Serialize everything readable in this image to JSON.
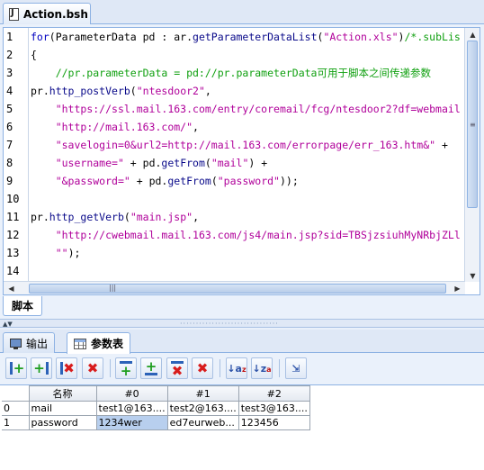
{
  "editor": {
    "file_tab": "Action.bsh",
    "bottom_tab": "脚本",
    "line_numbers": [
      "1",
      "2",
      "3",
      "4",
      "5",
      "6",
      "7",
      "8",
      "9",
      "10",
      "11",
      "12",
      "13",
      "14"
    ],
    "lines": [
      [
        {
          "t": "for",
          "c": "kw"
        },
        {
          "t": "(ParameterData pd : ar."
        },
        {
          "t": "getParameterDataList",
          "c": "fn"
        },
        {
          "t": "("
        },
        {
          "t": "\"Action.xls\"",
          "c": "str"
        },
        {
          "t": ")"
        },
        {
          "t": "/*.subLis",
          "c": "cmt"
        }
      ],
      [
        {
          "t": "{"
        }
      ],
      [
        {
          "t": "    //pr.parameterData = pd://pr.parameterData可用于脚本之间传递参数",
          "c": "cmt"
        }
      ],
      [
        {
          "t": "pr."
        },
        {
          "t": "http_postVerb",
          "c": "fn"
        },
        {
          "t": "("
        },
        {
          "t": "\"ntesdoor2\"",
          "c": "str"
        },
        {
          "t": ","
        }
      ],
      [
        {
          "t": "    "
        },
        {
          "t": "\"https://ssl.mail.163.com/entry/coremail/fcg/ntesdoor2?df=webmail",
          "c": "str"
        }
      ],
      [
        {
          "t": "    "
        },
        {
          "t": "\"http://mail.163.com/\"",
          "c": "str"
        },
        {
          "t": ","
        }
      ],
      [
        {
          "t": "    "
        },
        {
          "t": "\"savelogin=0&url2=http://mail.163.com/errorpage/err_163.htm&\"",
          "c": "str"
        },
        {
          "t": " +"
        }
      ],
      [
        {
          "t": "    "
        },
        {
          "t": "\"username=\"",
          "c": "str"
        },
        {
          "t": " + pd."
        },
        {
          "t": "getFrom",
          "c": "fn"
        },
        {
          "t": "("
        },
        {
          "t": "\"mail\"",
          "c": "str"
        },
        {
          "t": ") +"
        }
      ],
      [
        {
          "t": "    "
        },
        {
          "t": "\"&password=\"",
          "c": "str"
        },
        {
          "t": " + pd."
        },
        {
          "t": "getFrom",
          "c": "fn"
        },
        {
          "t": "("
        },
        {
          "t": "\"password\"",
          "c": "str"
        },
        {
          "t": "));"
        }
      ],
      [
        {
          "t": ""
        }
      ],
      [
        {
          "t": "pr."
        },
        {
          "t": "http_getVerb",
          "c": "fn"
        },
        {
          "t": "("
        },
        {
          "t": "\"main.jsp\"",
          "c": "str"
        },
        {
          "t": ","
        }
      ],
      [
        {
          "t": "    "
        },
        {
          "t": "\"http://cwebmail.mail.163.com/js4/main.jsp?sid=TBSjzsiuhMyNRbjZLl",
          "c": "str"
        }
      ],
      [
        {
          "t": "    "
        },
        {
          "t": "\"\"",
          "c": "str"
        },
        {
          "t": ");"
        }
      ],
      [
        {
          "t": ""
        }
      ]
    ]
  },
  "bottom_tabs": {
    "output": "输出",
    "params": "参数表"
  },
  "grid": {
    "headers": [
      "名称",
      "#0",
      "#1",
      "#2"
    ],
    "rows": [
      {
        "num": "0",
        "cells": [
          "mail",
          "test1@163....",
          "test2@163....",
          "test3@163...."
        ]
      },
      {
        "num": "1",
        "cells": [
          "password",
          "1234wer",
          "ed7eurweb...",
          "123456"
        ]
      }
    ]
  }
}
